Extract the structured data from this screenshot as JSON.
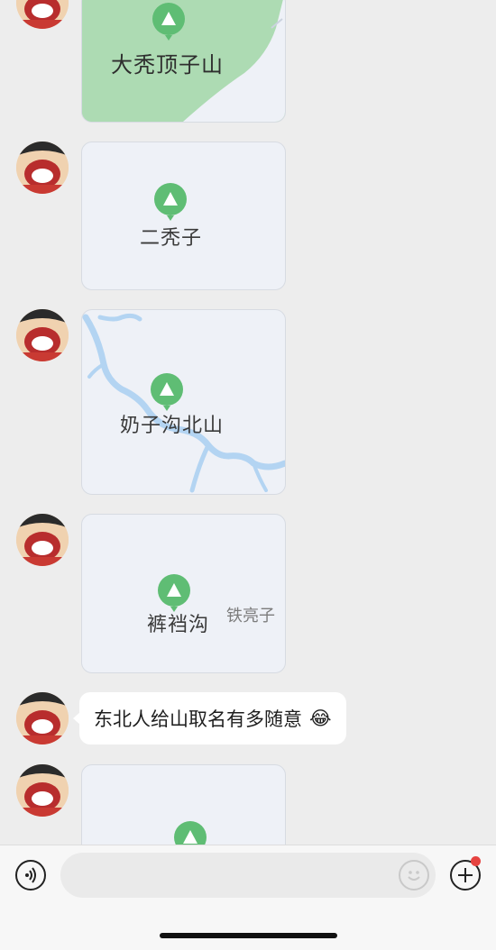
{
  "messages": [
    {
      "type": "location",
      "place": "大秃顶子山",
      "sub_label": ""
    },
    {
      "type": "location",
      "place": "二秃子",
      "sub_label": ""
    },
    {
      "type": "location",
      "place": "奶子沟北山",
      "sub_label": ""
    },
    {
      "type": "location",
      "place": "裤裆沟",
      "sub_label": "铁亮子"
    },
    {
      "type": "text",
      "text": "东北人给山取名有多随意",
      "emoji": "😂"
    },
    {
      "type": "location",
      "place": "",
      "sub_label": ""
    }
  ],
  "icons": {
    "location_pin": "mountain-pin-icon",
    "voice": "voice-icon",
    "emoji": "emoji-icon",
    "more": "plus-icon"
  },
  "colors": {
    "pin_green": "#5fbd74",
    "map_green": "#a9dcb0",
    "water_blue": "#b3d4f2",
    "bubble_white": "#ffffff",
    "notification_red": "#e64340"
  },
  "input": {
    "placeholder": "",
    "value": ""
  }
}
